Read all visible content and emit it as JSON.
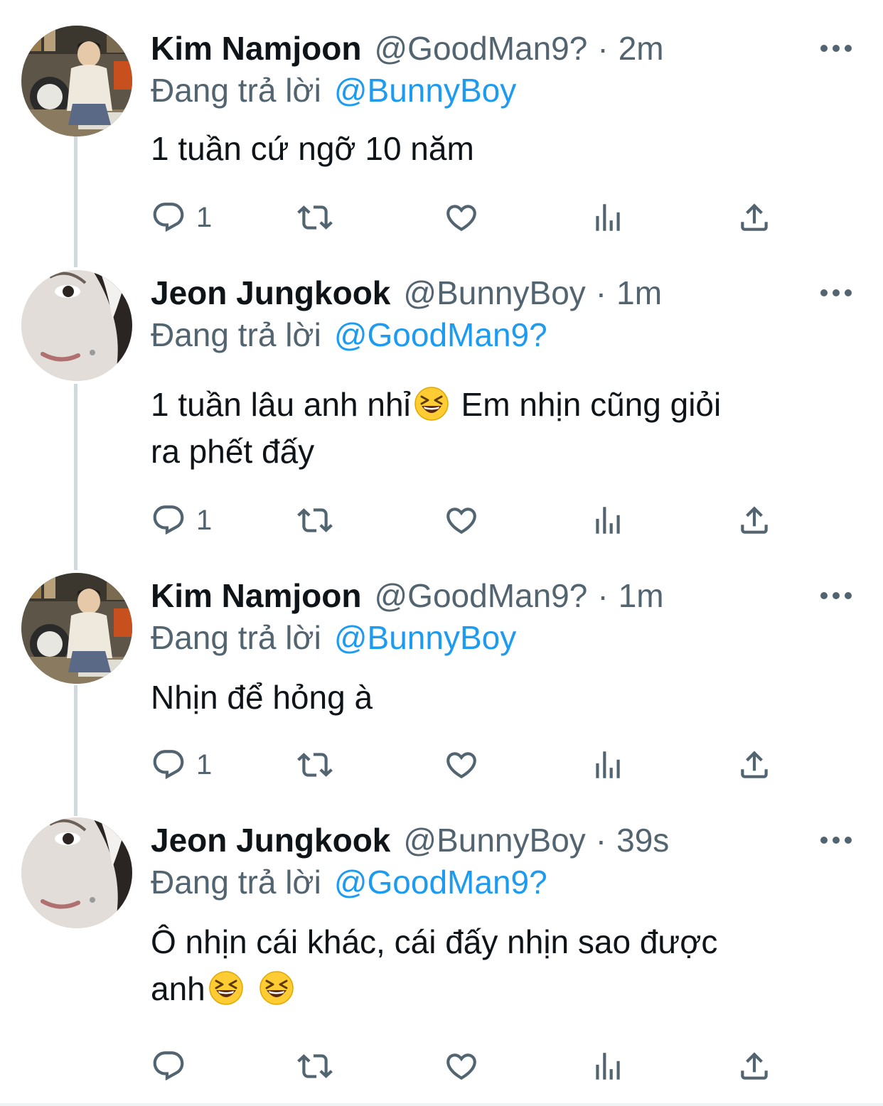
{
  "colors": {
    "accent": "#1d9bf0",
    "secondary_text": "#536471",
    "primary_text": "#0f1419",
    "thread_line": "#cfd9de"
  },
  "reply_prefix": "Đang trả lời",
  "tweets": [
    {
      "name": "Kim Namjoon",
      "handle": "@GoodMan9?",
      "separator": "·",
      "time": "2m",
      "reply_to": "@BunnyBoy",
      "text": "1 tuần cứ ngỡ 10 năm",
      "reply_count": "1"
    },
    {
      "name": "Jeon Jungkook",
      "handle": "@BunnyBoy",
      "separator": "·",
      "time": "1m",
      "reply_to": "@GoodMan9?",
      "text_parts": [
        "1 tuần lâu anh nhỉ",
        "Em nhịn cũng giỏi",
        "ra phết đấy"
      ],
      "emoji": "grinning-squinting-face",
      "reply_count": "1"
    },
    {
      "name": "Kim Namjoon",
      "handle": "@GoodMan9?",
      "separator": "·",
      "time": "1m",
      "reply_to": "@BunnyBoy",
      "text": "Nhịn để hỏng à",
      "reply_count": "1"
    },
    {
      "name": "Jeon Jungkook",
      "handle": "@BunnyBoy",
      "separator": "·",
      "time": "39s",
      "reply_to": "@GoodMan9?",
      "text_parts": [
        "Ô nhịn cái khác, cái đấy nhịn sao được",
        "anh"
      ],
      "emoji": "grinning-squinting-face",
      "reply_count": ""
    }
  ],
  "action_icons": [
    "reply-icon",
    "retweet-icon",
    "like-icon",
    "analytics-icon",
    "share-icon"
  ]
}
